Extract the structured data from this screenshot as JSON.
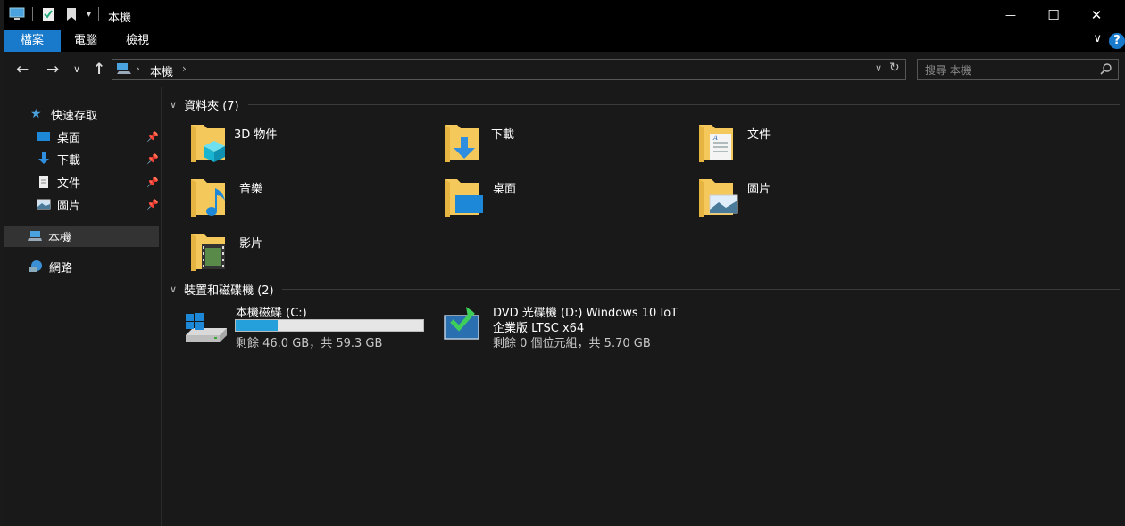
{
  "window": {
    "title": "本機",
    "minimize_glyph": "—",
    "maximize_glyph": "☐",
    "close_glyph": "✕"
  },
  "ribbon": {
    "tabs": [
      "檔案",
      "電腦",
      "檢視"
    ],
    "help": "?"
  },
  "address": {
    "crumb": "本機",
    "search_placeholder": "搜尋 本機"
  },
  "nav": {
    "quick_access": "快速存取",
    "pinned": [
      {
        "label": "桌面",
        "icon": "desktop-icon"
      },
      {
        "label": "下載",
        "icon": "download-icon"
      },
      {
        "label": "文件",
        "icon": "document-icon"
      },
      {
        "label": "圖片",
        "icon": "pictures-icon"
      }
    ],
    "this_pc": "本機",
    "network": "網路"
  },
  "groups": {
    "folders_header": "資料夾 (7)",
    "drives_header": "裝置和磁碟機 (2)"
  },
  "folders": [
    {
      "label": "3D 物件",
      "icon": "3d-objects-folder-icon"
    },
    {
      "label": "下載",
      "icon": "downloads-folder-icon"
    },
    {
      "label": "文件",
      "icon": "documents-folder-icon"
    },
    {
      "label": "音樂",
      "icon": "music-folder-icon"
    },
    {
      "label": "桌面",
      "icon": "desktop-folder-icon"
    },
    {
      "label": "圖片",
      "icon": "pictures-folder-icon"
    },
    {
      "label": "影片",
      "icon": "videos-folder-icon"
    }
  ],
  "drives": [
    {
      "label": "本機磁碟 (C:)",
      "free_text": "剩餘 46.0 GB，共 59.3 GB",
      "used_fraction": 0.224,
      "icon": "local-disk-icon"
    },
    {
      "label_line1": "DVD 光碟機 (D:) Windows 10 IoT",
      "label_line2": "企業版 LTSC x64",
      "free_text": "剩餘 0 個位元組，共 5.70 GB",
      "icon": "dvd-drive-icon"
    }
  ],
  "colors": {
    "accent": "#1979ca",
    "progress": "#26a0da",
    "folder": "#f4c85a"
  }
}
